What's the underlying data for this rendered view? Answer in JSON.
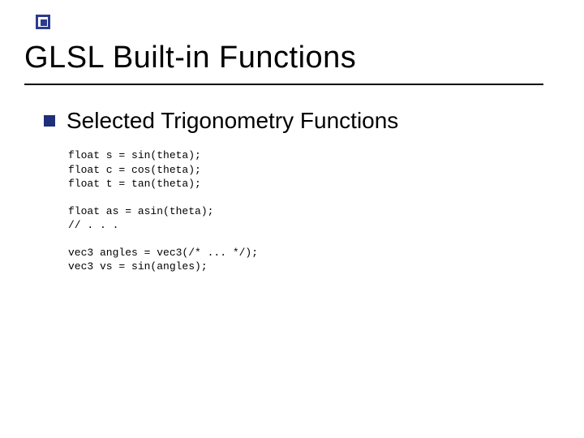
{
  "accent_color": "#2a3b8f",
  "title": "GLSL Built-in Functions",
  "bullet": "Selected Trigonometry Functions",
  "code_block_1": "float s = sin(theta);\nfloat c = cos(theta);\nfloat t = tan(theta);",
  "code_block_2": "float as = asin(theta);\n// . . .",
  "code_block_3": "vec3 angles = vec3(/* ... */);\nvec3 vs = sin(angles);"
}
